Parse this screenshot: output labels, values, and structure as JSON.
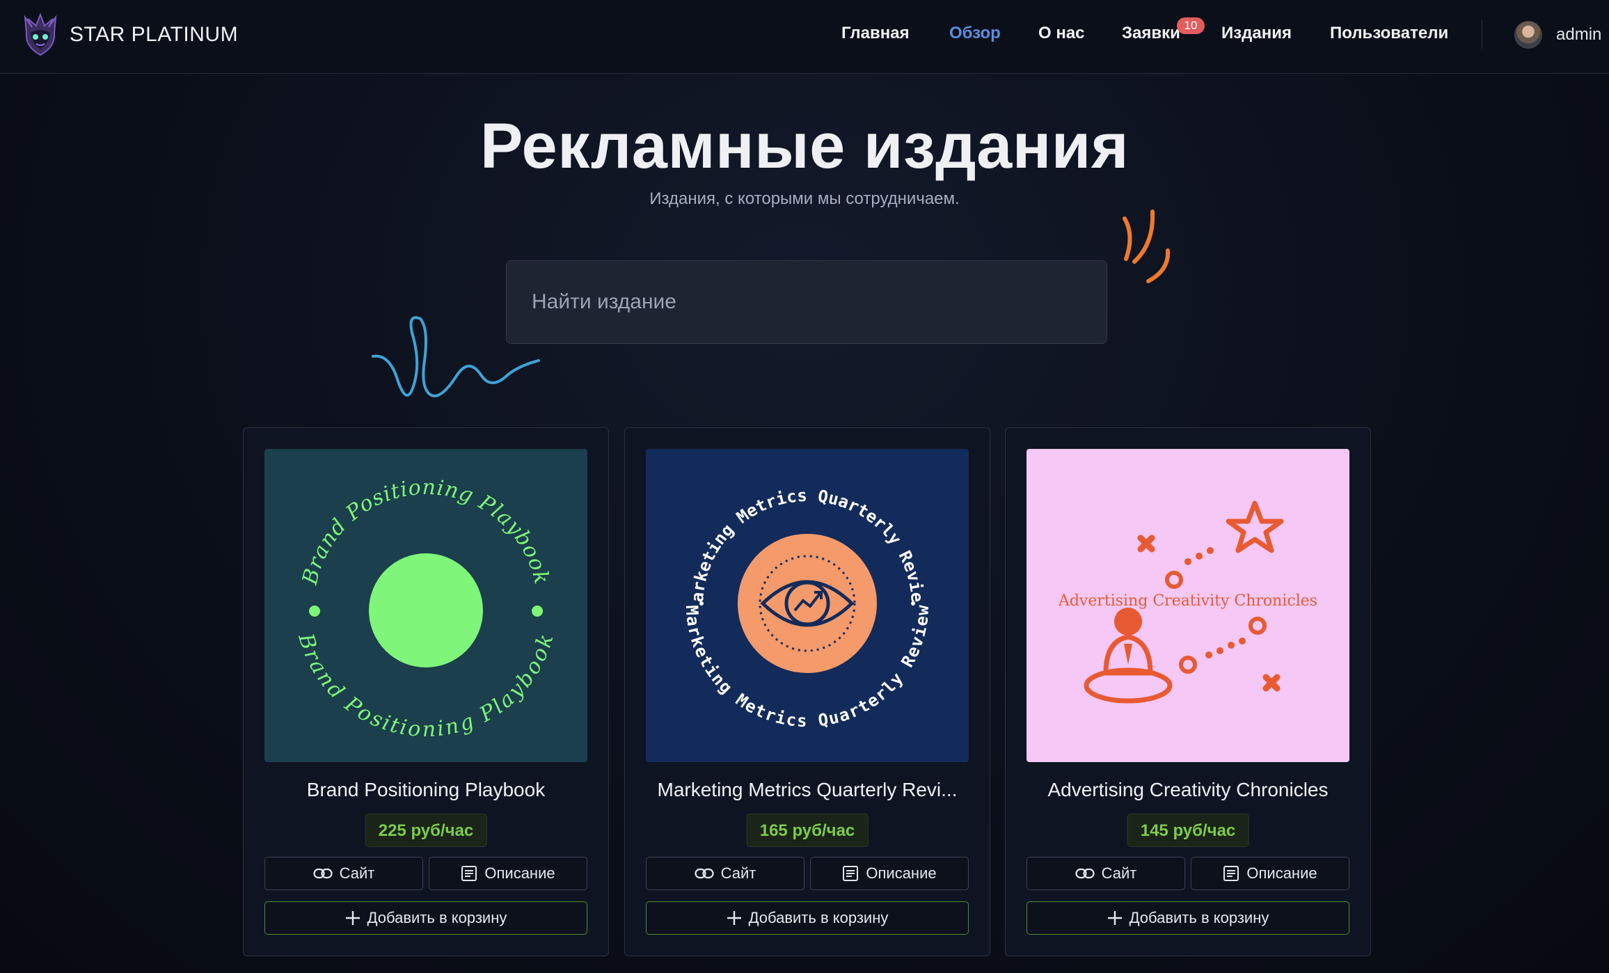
{
  "brand": {
    "name": "STAR PLATINUM"
  },
  "nav": {
    "items": [
      {
        "label": "Главная",
        "active": false
      },
      {
        "label": "Обзор",
        "active": true
      },
      {
        "label": "О нас",
        "active": false
      },
      {
        "label": "Заявки",
        "active": false,
        "badge": "10"
      },
      {
        "label": "Издания",
        "active": false
      },
      {
        "label": "Пользователи",
        "active": false
      }
    ],
    "user": {
      "name": "admin"
    }
  },
  "hero": {
    "title": "Рекламные издания",
    "subtitle": "Издания, с которыми мы сотрудничаем."
  },
  "search": {
    "placeholder": "Найти издание",
    "value": ""
  },
  "cards": [
    {
      "title": "Brand Positioning Playbook",
      "price": "225 руб/час",
      "cover_text": "Brand Positioning Playbook",
      "cover_bg": "#1b3f4c",
      "accent": "#7ff57a",
      "site_label": "Сайт",
      "desc_label": "Описание",
      "cart_label": "Добавить в корзину"
    },
    {
      "title": "Marketing Metrics Quarterly Revi...",
      "price": "165 руб/час",
      "cover_text": "Marketing Metrics Quarterly Review",
      "cover_bg": "#132b5a",
      "accent": "#f49a6b",
      "site_label": "Сайт",
      "desc_label": "Описание",
      "cart_label": "Добавить в корзину"
    },
    {
      "title": "Advertising Creativity Chronicles",
      "price": "145 руб/час",
      "cover_text": "Advertising Creativity Chronicles",
      "cover_bg": "#f5c8f5",
      "accent": "#e85a32",
      "site_label": "Сайт",
      "desc_label": "Описание",
      "cart_label": "Добавить в корзину"
    }
  ],
  "colors": {
    "active_link": "#5b8fdc",
    "badge": "#e35d5d",
    "price": "#7dcc4a",
    "squiggle_blue": "#3fa3d8",
    "squiggle_orange": "#ee7a2d"
  },
  "icons": [
    "link-icon",
    "document-icon",
    "plus-icon"
  ]
}
